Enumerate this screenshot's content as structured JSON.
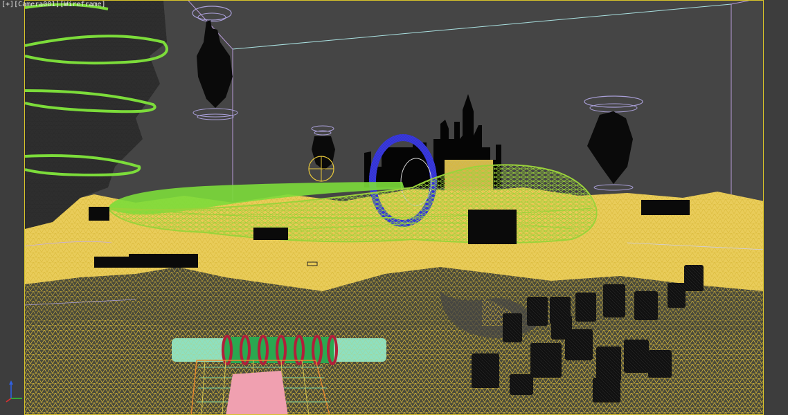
{
  "viewport": {
    "label_menu": "[+]",
    "label_camera": "[Camera001]",
    "label_shading": "[Wireframe]"
  },
  "colors": {
    "background": "#454545",
    "terrain_fill": "#e9cc5a",
    "terrain_wire": "#f2d86a",
    "viewport_border": "#d8c42a",
    "spline_green": "#7cdc3a",
    "ship_wire": "#9ad33a",
    "ring_blue": "#3333cc",
    "buildings": "#000000",
    "gizmo_lavender": "#a99fd8",
    "pipe_teal": "#8ee0c0",
    "coil_red": "#b0203a",
    "pink_box": "#f0a0b0"
  },
  "gizmo": {
    "x_axis_color": "#e03030",
    "y_axis_color": "#30c030",
    "z_axis_color": "#3060e0"
  }
}
